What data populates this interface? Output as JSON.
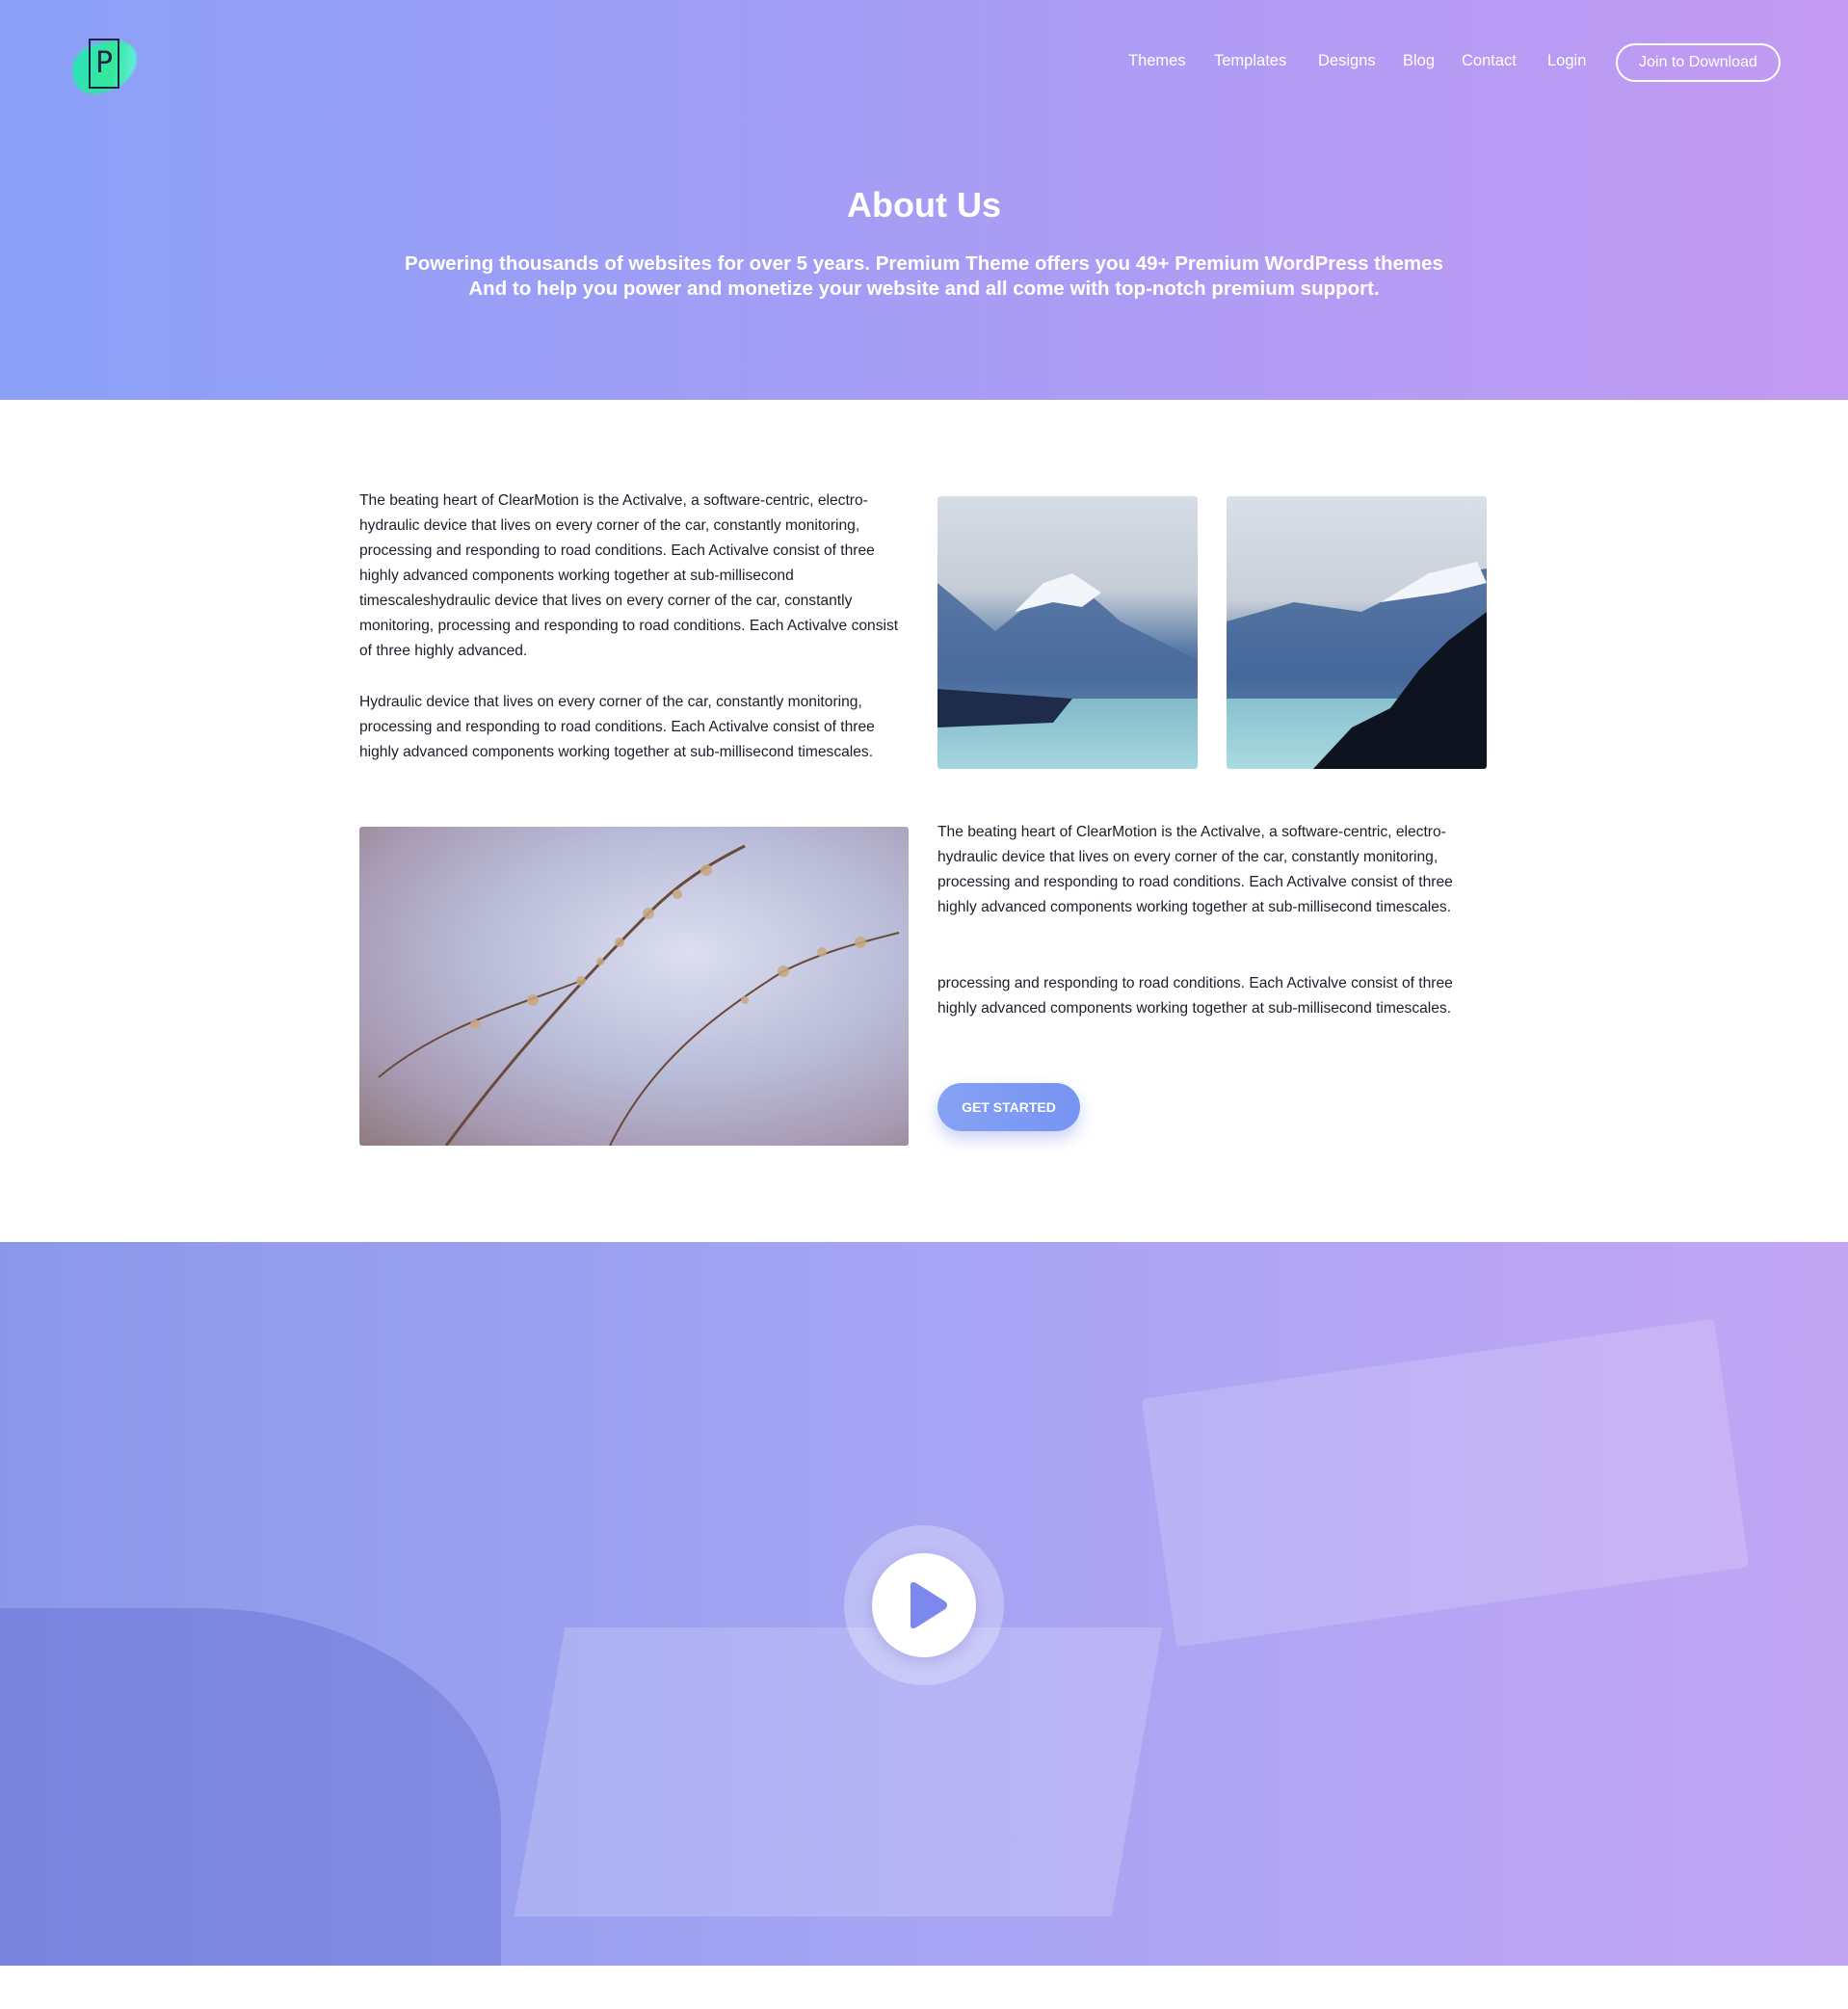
{
  "header": {
    "logo_letter": "P",
    "nav": [
      {
        "label": "Themes"
      },
      {
        "label": "Templates"
      },
      {
        "label": "Designs"
      },
      {
        "label": "Blog"
      },
      {
        "label": "Contact"
      },
      {
        "label": "Login"
      }
    ],
    "join_label": "Join to Download"
  },
  "hero": {
    "title": "About Us",
    "subtitle_line1": "Powering thousands of websites for over 5 years. Premium Theme offers you 49+ Premium WordPress themes",
    "subtitle_line2": "And  to help you power and monetize your website and all come with top-notch  premium support."
  },
  "section1": {
    "p1": "The beating heart of ClearMotion is the Activalve, a software-centric, electro-hydraulic device that lives on every corner of the car, constantly monitoring, processing and responding to road conditions. Each Activalve consist of three highly advanced components working together at sub-millisecond timescaleshydraulic device that lives on every corner of the car, constantly monitoring, processing and responding to road conditions. Each Activalve consist of three highly advanced.",
    "p2": "Hydraulic device that lives on every corner of the car, constantly monitoring, processing and responding to road conditions. Each Activalve consist of three highly advanced components working together at sub-millisecond timescales."
  },
  "section2": {
    "p1": "The beating heart of ClearMotion is the Activalve, a software-centric, electro-hydraulic device that lives on every corner of the car, constantly monitoring, processing and responding to road conditions. Each Activalve consist of three highly advanced components working together at sub-millisecond timescales.",
    "p2": "processing and responding to road conditions. Each Activalve consist of three highly advanced components working together at sub-millisecond timescales.",
    "cta_label": "GET STARTED"
  },
  "colors": {
    "hero_gradient_start": "#8aa0f7",
    "hero_gradient_end": "#c39af2",
    "accent": "#7694f2",
    "text": "#1d1d2b"
  },
  "icons": {
    "play": "play-icon"
  }
}
